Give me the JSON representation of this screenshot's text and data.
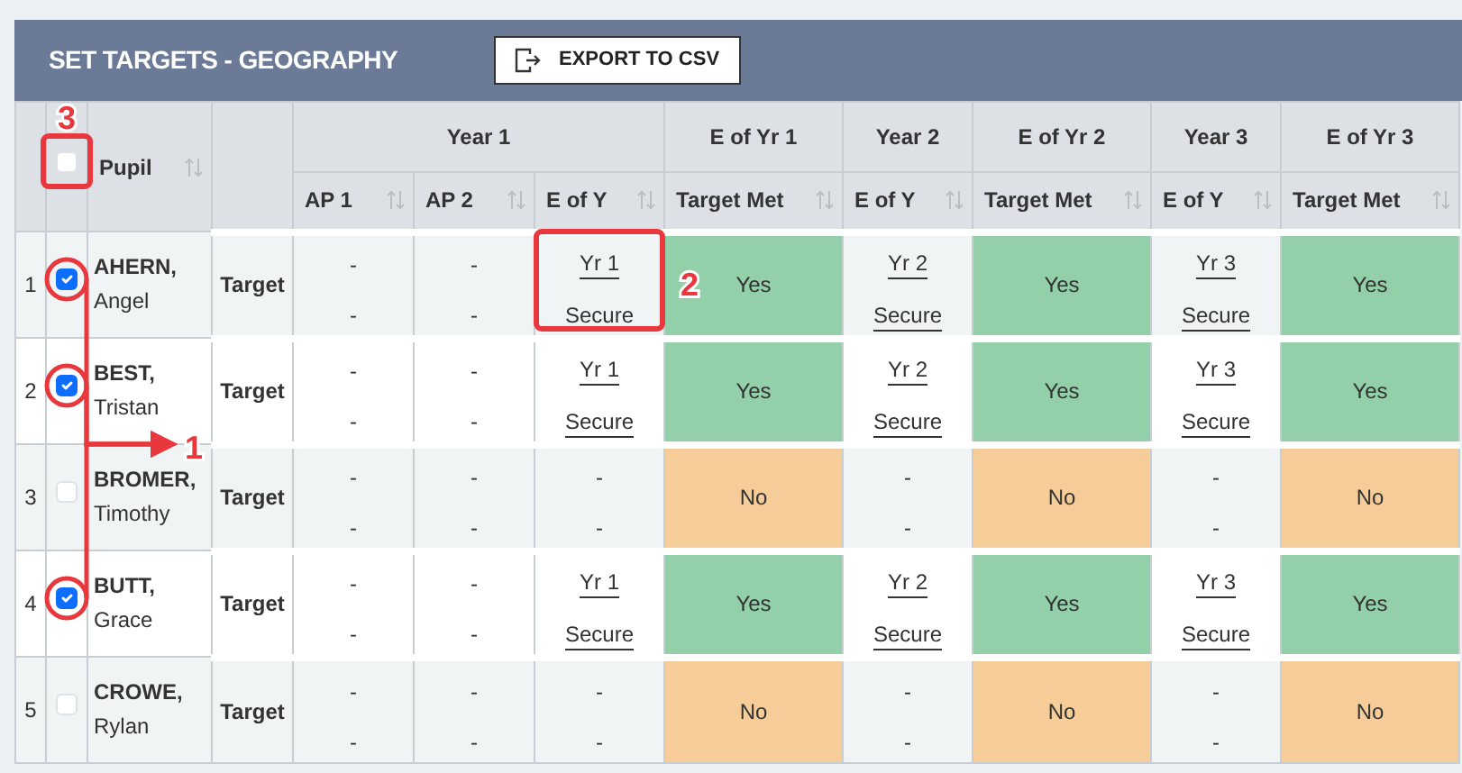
{
  "title": "SET TARGETS - GEOGRAPHY",
  "export_button": {
    "label": "EXPORT TO CSV"
  },
  "table": {
    "pupil_header": "Pupil",
    "select_all_checked": false,
    "groups": [
      {
        "label": "Year 1",
        "columns": [
          "AP 1",
          "AP 2",
          "E of Y"
        ]
      },
      {
        "label": "E of Yr 1",
        "columns": [
          "Target Met"
        ]
      },
      {
        "label": "Year 2",
        "columns": [
          "E of Y"
        ]
      },
      {
        "label": "E of Yr 2",
        "columns": [
          "Target Met"
        ]
      },
      {
        "label": "Year 3",
        "columns": [
          "E of Y"
        ]
      },
      {
        "label": "E of Yr 3",
        "columns": [
          "Target Met"
        ]
      }
    ],
    "rows": [
      {
        "number": "1",
        "checked": true,
        "surname": "AHERN,",
        "forename": "Angel",
        "row_label": "Target",
        "cells": [
          {
            "kind": "empty",
            "top": "-",
            "bottom": "-"
          },
          {
            "kind": "empty",
            "top": "-",
            "bottom": "-"
          },
          {
            "kind": "grade",
            "top": "Yr 1",
            "bottom": "Secure"
          },
          {
            "kind": "status",
            "text": "Yes",
            "color": "#93cfa8"
          },
          {
            "kind": "grade",
            "top": "Yr 2",
            "bottom": "Secure"
          },
          {
            "kind": "status",
            "text": "Yes",
            "color": "#93cfa8"
          },
          {
            "kind": "grade",
            "top": "Yr 3",
            "bottom": "Secure"
          },
          {
            "kind": "status",
            "text": "Yes",
            "color": "#93cfa8"
          }
        ]
      },
      {
        "number": "2",
        "checked": true,
        "surname": "BEST,",
        "forename": "Tristan",
        "row_label": "Target",
        "cells": [
          {
            "kind": "empty",
            "top": "-",
            "bottom": "-"
          },
          {
            "kind": "empty",
            "top": "-",
            "bottom": "-"
          },
          {
            "kind": "grade",
            "top": "Yr 1",
            "bottom": "Secure"
          },
          {
            "kind": "status",
            "text": "Yes",
            "color": "#93cfa8"
          },
          {
            "kind": "grade",
            "top": "Yr 2",
            "bottom": "Secure"
          },
          {
            "kind": "status",
            "text": "Yes",
            "color": "#93cfa8"
          },
          {
            "kind": "grade",
            "top": "Yr 3",
            "bottom": "Secure"
          },
          {
            "kind": "status",
            "text": "Yes",
            "color": "#93cfa8"
          }
        ]
      },
      {
        "number": "3",
        "checked": false,
        "surname": "BROMER,",
        "forename": "Timothy",
        "row_label": "Target",
        "cells": [
          {
            "kind": "empty",
            "top": "-",
            "bottom": "-"
          },
          {
            "kind": "empty",
            "top": "-",
            "bottom": "-"
          },
          {
            "kind": "empty",
            "top": "-",
            "bottom": "-"
          },
          {
            "kind": "status",
            "text": "No",
            "color": "#f6cd98"
          },
          {
            "kind": "empty",
            "top": "-",
            "bottom": "-"
          },
          {
            "kind": "status",
            "text": "No",
            "color": "#f6cd98"
          },
          {
            "kind": "empty",
            "top": "-",
            "bottom": "-"
          },
          {
            "kind": "status",
            "text": "No",
            "color": "#f6cd98"
          }
        ]
      },
      {
        "number": "4",
        "checked": true,
        "surname": "BUTT,",
        "forename": "Grace",
        "row_label": "Target",
        "cells": [
          {
            "kind": "empty",
            "top": "-",
            "bottom": "-"
          },
          {
            "kind": "empty",
            "top": "-",
            "bottom": "-"
          },
          {
            "kind": "grade",
            "top": "Yr 1",
            "bottom": "Secure"
          },
          {
            "kind": "status",
            "text": "Yes",
            "color": "#93cfa8"
          },
          {
            "kind": "grade",
            "top": "Yr 2",
            "bottom": "Secure"
          },
          {
            "kind": "status",
            "text": "Yes",
            "color": "#93cfa8"
          },
          {
            "kind": "grade",
            "top": "Yr 3",
            "bottom": "Secure"
          },
          {
            "kind": "status",
            "text": "Yes",
            "color": "#93cfa8"
          }
        ]
      },
      {
        "number": "5",
        "checked": false,
        "surname": "CROWE,",
        "forename": "Rylan",
        "row_label": "Target",
        "cells": [
          {
            "kind": "empty",
            "top": "-",
            "bottom": "-"
          },
          {
            "kind": "empty",
            "top": "-",
            "bottom": "-"
          },
          {
            "kind": "empty",
            "top": "-",
            "bottom": "-"
          },
          {
            "kind": "status",
            "text": "No",
            "color": "#f6cd98"
          },
          {
            "kind": "empty",
            "top": "-",
            "bottom": "-"
          },
          {
            "kind": "status",
            "text": "No",
            "color": "#f6cd98"
          },
          {
            "kind": "empty",
            "top": "-",
            "bottom": "-"
          },
          {
            "kind": "status",
            "text": "No",
            "color": "#f6cd98"
          }
        ]
      }
    ]
  },
  "annotations": [
    {
      "kind": "arrows-to-checked",
      "label": "1"
    },
    {
      "kind": "box-first-grade",
      "label": "2"
    },
    {
      "kind": "box-select-all",
      "label": "3"
    }
  ]
}
